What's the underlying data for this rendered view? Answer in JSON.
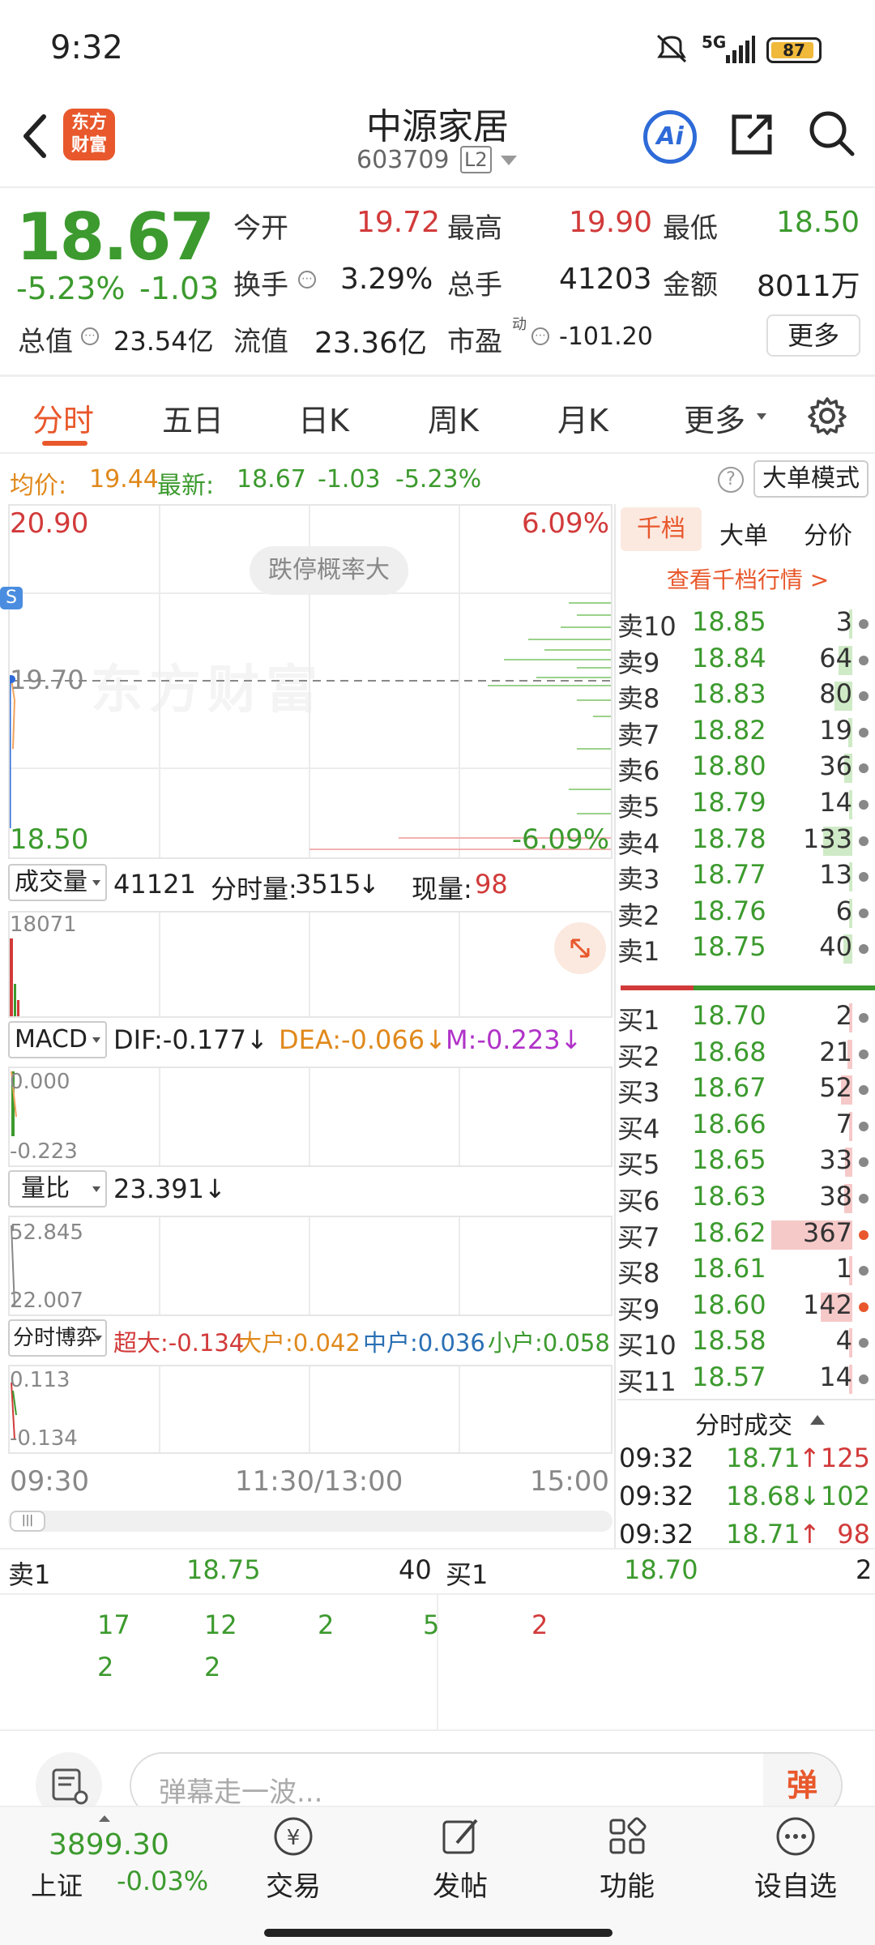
{
  "status": {
    "time": "9:32",
    "network": "5G",
    "battery": "87"
  },
  "header": {
    "title": "中源家居",
    "code": "603709",
    "level": "L2",
    "brand_l1": "东方",
    "brand_l2": "财富",
    "ai": "Ai"
  },
  "quote": {
    "price": "18.67",
    "pct": "-5.23%",
    "chg": "-1.03",
    "r1": [
      {
        "label": "今开",
        "value": "19.72"
      },
      {
        "label": "最高",
        "value": "19.90"
      },
      {
        "label": "最低",
        "value": "18.50"
      }
    ],
    "r2": [
      {
        "label": "换手",
        "value": "3.29%"
      },
      {
        "label": "总手",
        "value": "41203"
      },
      {
        "label": "金额",
        "value": "8011万"
      }
    ],
    "r3": [
      {
        "label": "总值",
        "value": "23.54亿"
      },
      {
        "label": "流值",
        "value": "23.36亿"
      },
      {
        "label": "市盈",
        "sup": "动",
        "value": "-101.20"
      }
    ],
    "more": "更多"
  },
  "tabs": [
    "分时",
    "五日",
    "日K",
    "周K",
    "月K",
    "更多"
  ],
  "infobar": {
    "avg_label": "均价:",
    "avg": "19.44",
    "latest_label": "最新:",
    "latest": "18.67",
    "chg": "-1.03",
    "pct": "-5.23%",
    "mode": "大单模式"
  },
  "chart": {
    "top_price": "20.90",
    "top_pct": "6.09%",
    "mid_price": "19.70",
    "bot_price": "18.50",
    "bot_pct": "-6.09%",
    "badge": "跌停概率大",
    "watermark": "东方财富",
    "s": "S"
  },
  "vol": {
    "label": "成交量",
    "value": "41121",
    "fs_label": "分时量:",
    "fs": "3515",
    "arrow": "↓",
    "cur_label": "现量:",
    "cur": "98",
    "axis": "18071"
  },
  "macd": {
    "label": "MACD",
    "dif": "DIF:-0.177↓",
    "dea": "DEA:-0.066↓",
    "m": "M:-0.223↓",
    "a1": "0.000",
    "a2": "-0.223"
  },
  "lb": {
    "label": "量比",
    "value": "23.391↓",
    "a1": "52.845",
    "a2": "22.007"
  },
  "bo": {
    "label": "分时博弈",
    "c1": "超大:-0.134",
    "c2": "大户:0.042",
    "c3": "中户:0.036",
    "c4": "小户:0.058",
    "a1": "0.113",
    "a2": "-0.134"
  },
  "time_axis": [
    "09:30",
    "11:30/13:00",
    "15:00"
  ],
  "ob_tabs": [
    "千档",
    "大单",
    "分价"
  ],
  "ob_link": "查看千档行情 >",
  "asks": [
    {
      "l": "卖10",
      "p": "18.85",
      "v": "3"
    },
    {
      "l": "卖9",
      "p": "18.84",
      "v": "64"
    },
    {
      "l": "卖8",
      "p": "18.83",
      "v": "80"
    },
    {
      "l": "卖7",
      "p": "18.82",
      "v": "19"
    },
    {
      "l": "卖6",
      "p": "18.80",
      "v": "36"
    },
    {
      "l": "卖5",
      "p": "18.79",
      "v": "14"
    },
    {
      "l": "卖4",
      "p": "18.78",
      "v": "133"
    },
    {
      "l": "卖3",
      "p": "18.77",
      "v": "13"
    },
    {
      "l": "卖2",
      "p": "18.76",
      "v": "6"
    },
    {
      "l": "卖1",
      "p": "18.75",
      "v": "40"
    }
  ],
  "bids": [
    {
      "l": "买1",
      "p": "18.70",
      "v": "2"
    },
    {
      "l": "买2",
      "p": "18.68",
      "v": "21"
    },
    {
      "l": "买3",
      "p": "18.67",
      "v": "52"
    },
    {
      "l": "买4",
      "p": "18.66",
      "v": "7"
    },
    {
      "l": "买5",
      "p": "18.65",
      "v": "33"
    },
    {
      "l": "买6",
      "p": "18.63",
      "v": "38"
    },
    {
      "l": "买7",
      "p": "18.62",
      "v": "367"
    },
    {
      "l": "买8",
      "p": "18.61",
      "v": "1"
    },
    {
      "l": "买9",
      "p": "18.60",
      "v": "142"
    },
    {
      "l": "买10",
      "p": "18.58",
      "v": "4"
    },
    {
      "l": "买11",
      "p": "18.57",
      "v": "14"
    }
  ],
  "ticks_title": "分时成交",
  "ticks": [
    {
      "t": "09:32",
      "p": "18.71",
      "a": "↑",
      "v": "125"
    },
    {
      "t": "09:32",
      "p": "18.68",
      "a": "↓",
      "v": "102"
    },
    {
      "t": "09:32",
      "p": "18.71",
      "a": "↑",
      "v": "98"
    }
  ],
  "queue": {
    "sell_label": "卖1",
    "sell_price": "18.75",
    "sell_vol": "40",
    "buy_label": "买1",
    "buy_price": "18.70",
    "buy_vol": "2",
    "sell_row1": [
      "17",
      "12",
      "2",
      "5"
    ],
    "sell_row2": [
      "2",
      "2"
    ],
    "buy_row1": [
      "2"
    ]
  },
  "comment": {
    "placeholder": "弹幕走一波...",
    "btn": "弹"
  },
  "index": {
    "value": "3899.30",
    "name": "上证",
    "pct": "-0.03%"
  },
  "nav": [
    "交易",
    "发帖",
    "功能",
    "设自选"
  ]
}
